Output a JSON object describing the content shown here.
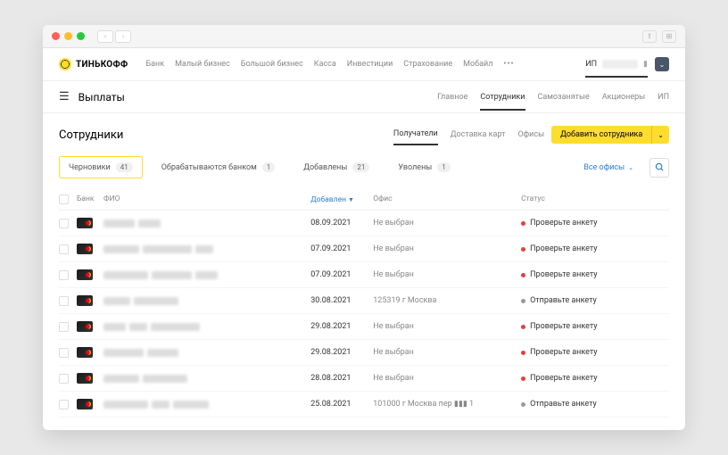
{
  "brand": "ТИНЬКОФФ",
  "topnav": [
    "Банк",
    "Малый бизнес",
    "Большой бизнес",
    "Касса",
    "Инвестиции",
    "Страхование",
    "Мобайл"
  ],
  "user_prefix": "ИП",
  "page_title": "Выплаты",
  "subnav": {
    "items": [
      "Главное",
      "Сотрудники",
      "Самозанятые",
      "Акционеры",
      "ИП"
    ],
    "active": 1
  },
  "section_title": "Сотрудники",
  "sec_tabs": {
    "items": [
      "Получатели",
      "Доставка карт",
      "Офисы"
    ],
    "active": 0
  },
  "add_button": "Добавить сотрудника",
  "filters": [
    {
      "label": "Черновики",
      "count": "41",
      "active": true
    },
    {
      "label": "Обрабатываются банком",
      "count": "1",
      "active": false
    },
    {
      "label": "Добавлены",
      "count": "21",
      "active": false
    },
    {
      "label": "Уволены",
      "count": "1",
      "active": false
    }
  ],
  "office_selector": "Все офисы",
  "columns": {
    "bank": "Банк",
    "fio": "ФИО",
    "date": "Добавлен",
    "office": "Офис",
    "status": "Статус"
  },
  "rows": [
    {
      "date": "08.09.2021",
      "office": "Не выбран",
      "status": "Проверьте анкету",
      "dot": "red",
      "fio_w": [
        35,
        25
      ]
    },
    {
      "date": "07.09.2021",
      "office": "Не выбран",
      "status": "Проверьте анкету",
      "dot": "red",
      "fio_w": [
        40,
        55,
        20
      ]
    },
    {
      "date": "07.09.2021",
      "office": "Не выбран",
      "status": "Проверьте анкету",
      "dot": "red",
      "fio_w": [
        50,
        45,
        25
      ]
    },
    {
      "date": "30.08.2021",
      "office": "125319 г Москва",
      "status": "Отправьте анкету",
      "dot": "gray",
      "fio_w": [
        30,
        50
      ]
    },
    {
      "date": "29.08.2021",
      "office": "Не выбран",
      "status": "Проверьте анкету",
      "dot": "red",
      "fio_w": [
        25,
        20,
        55
      ]
    },
    {
      "date": "29.08.2021",
      "office": "Не выбран",
      "status": "Проверьте анкету",
      "dot": "red",
      "fio_w": [
        45,
        35
      ]
    },
    {
      "date": "28.08.2021",
      "office": "Не выбран",
      "status": "Проверьте анкету",
      "dot": "red",
      "fio_w": [
        40,
        50
      ]
    },
    {
      "date": "25.08.2021",
      "office": "101000 г Москва пер ▮▮▮ 1",
      "status": "Отправьте анкету",
      "dot": "gray",
      "fio_w": [
        50,
        20,
        40
      ]
    }
  ]
}
